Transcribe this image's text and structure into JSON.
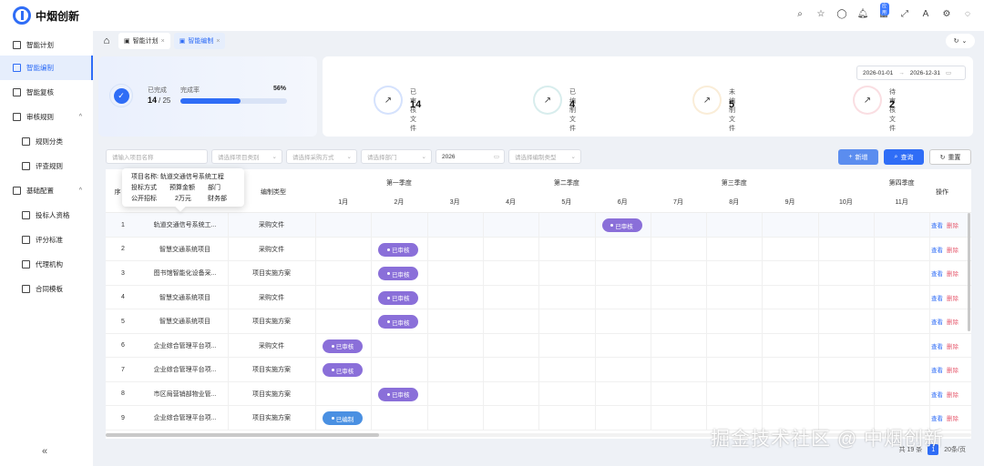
{
  "app": {
    "title": "中烟创新"
  },
  "sidebar": {
    "items": [
      {
        "label": "智能计划",
        "icon": "calendar-icon",
        "active": false,
        "sub": false
      },
      {
        "label": "智能编制",
        "icon": "edit-icon",
        "active": true,
        "sub": false
      },
      {
        "label": "智能复核",
        "icon": "check-icon",
        "active": false,
        "sub": false
      },
      {
        "label": "审核规则",
        "icon": "branch-icon",
        "active": false,
        "sub": false,
        "expand": "^"
      },
      {
        "label": "规则分类",
        "icon": "table-icon",
        "active": false,
        "sub": true
      },
      {
        "label": "评查规则",
        "icon": "doc-icon",
        "active": false,
        "sub": true
      },
      {
        "label": "基础配置",
        "icon": "settings-icon",
        "active": false,
        "sub": false,
        "expand": "^"
      },
      {
        "label": "投标人资格",
        "icon": "doc-icon",
        "active": false,
        "sub": true
      },
      {
        "label": "评分标准",
        "icon": "doc-icon",
        "active": false,
        "sub": true
      },
      {
        "label": "代理机构",
        "icon": "swap-icon",
        "active": false,
        "sub": true
      },
      {
        "label": "合同模板",
        "icon": "template-icon",
        "active": false,
        "sub": true
      }
    ],
    "collapse": "«"
  },
  "top_icons": {
    "badge": "应用"
  },
  "tabs": [
    {
      "label": "智能计划",
      "close": "×",
      "active": false
    },
    {
      "label": "智能编制",
      "close": "×",
      "active": true
    }
  ],
  "progress": {
    "done_label": "已完成",
    "done_value": "14",
    "total": "/ 25",
    "rate_label": "完成率",
    "rate_text": "56%",
    "rate": 0.56
  },
  "stats": [
    {
      "label": "已审核文件",
      "value": "14",
      "color": "#2f6df6"
    },
    {
      "label": "已编制文件",
      "value": "4",
      "color": "#3aa5a5"
    },
    {
      "label": "未编制文件",
      "value": "5",
      "color": "#e8a33c"
    },
    {
      "label": "待审核文件",
      "value": "2",
      "color": "#e65a6e"
    }
  ],
  "date_range": {
    "start": "2026-01-01",
    "sep": "→",
    "end": "2026-12-31"
  },
  "filters": {
    "project_name": "请输入项目名称",
    "project_type": "请选择项目类别",
    "purchase_method": "请选择采购方式",
    "department": "请选择部门",
    "year": "2026",
    "file_type": "请选择编制类型"
  },
  "buttons": {
    "add": "新增",
    "search": "查询",
    "reset": "重置"
  },
  "table": {
    "col_seq": "序",
    "col_type": "编制类型",
    "col_ops": "操作",
    "quarters": [
      "第一季度",
      "第二季度",
      "第三季度",
      "第四季度"
    ],
    "months": [
      "1月",
      "2月",
      "3月",
      "4月",
      "5月",
      "6月",
      "7月",
      "8月",
      "9月",
      "10月",
      "11月"
    ],
    "rows": [
      {
        "no": "1",
        "name": "轨道交通信号系统工...",
        "type": "采购文件",
        "status": "已审核",
        "month": 6,
        "color": "#8a6fd9"
      },
      {
        "no": "2",
        "name": "智慧交通系统项目",
        "type": "采购文件",
        "status": "已审核",
        "month": 2,
        "color": "#8a6fd9"
      },
      {
        "no": "3",
        "name": "图书馆智能化设备采...",
        "type": "项目实施方案",
        "status": "已审核",
        "month": 2,
        "color": "#8a6fd9"
      },
      {
        "no": "4",
        "name": "智慧交通系统项目",
        "type": "采购文件",
        "status": "已审核",
        "month": 2,
        "color": "#8a6fd9"
      },
      {
        "no": "5",
        "name": "智慧交通系统项目",
        "type": "项目实施方案",
        "status": "已审核",
        "month": 2,
        "color": "#8a6fd9"
      },
      {
        "no": "6",
        "name": "企业综合管理平台项...",
        "type": "采购文件",
        "status": "已审核",
        "month": 1,
        "color": "#8a6fd9"
      },
      {
        "no": "7",
        "name": "企业综合管理平台项...",
        "type": "项目实施方案",
        "status": "已审核",
        "month": 1,
        "color": "#8a6fd9"
      },
      {
        "no": "8",
        "name": "市区局营销部物业管...",
        "type": "项目实施方案",
        "status": "已审核",
        "month": 2,
        "color": "#8a6fd9"
      },
      {
        "no": "9",
        "name": "企业综合管理平台项...",
        "type": "项目实施方案",
        "status": "已编制",
        "month": 1,
        "color": "#4a90e2"
      }
    ],
    "op_view": "查看",
    "op_delete": "删除"
  },
  "tooltip": {
    "name_label": "项目名称:",
    "name_value": "轨道交通信号系统工程",
    "method_label": "投标方式",
    "budget_label": "预算金额",
    "dept_label": "部门",
    "method_value": "公开招标",
    "budget_value": "2万元",
    "dept_value": "财务部"
  },
  "pager": {
    "total": "共 19 条",
    "page": "1",
    "size": "20条/页"
  },
  "watermark": "掘金技术社区 @ 中烟创新"
}
